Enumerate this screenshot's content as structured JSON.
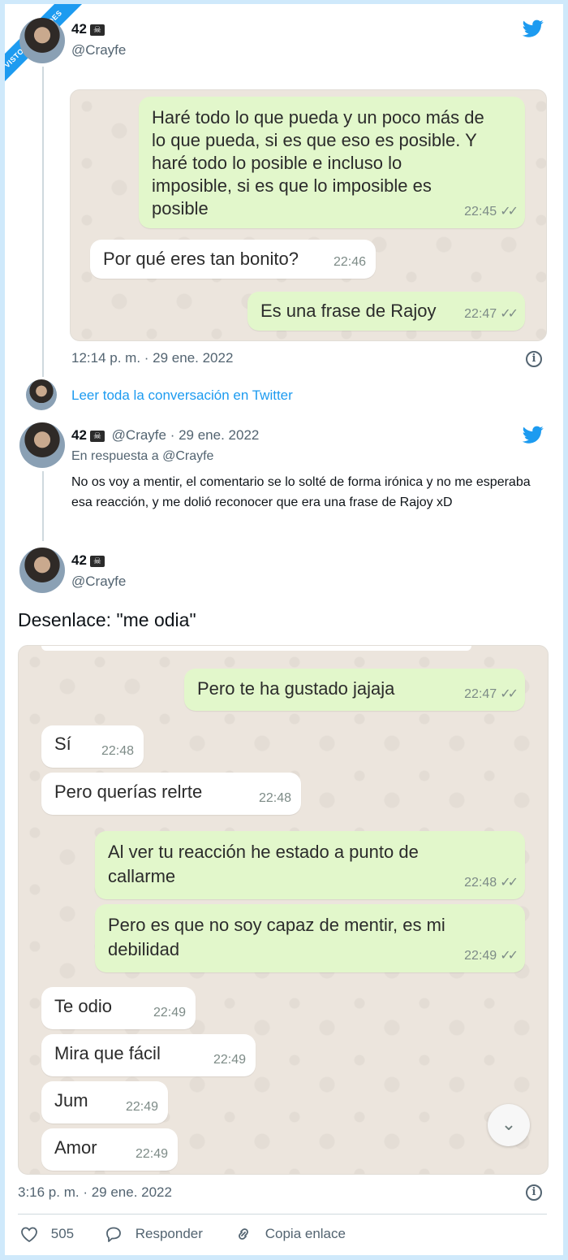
{
  "tweet1": {
    "name": "42",
    "handle": "@Crayfe",
    "chat": {
      "msg1_text": "Haré todo lo que pueda y un poco más de\nlo que pueda, si es que eso es posible. Y\nharé todo lo posible e incluso lo\nimposible, si es que lo imposible es\nposible",
      "msg1_time": "22:45",
      "msg2_text": "Por qué eres tan bonito?",
      "msg2_time": "22:46",
      "msg3_text": "Es una frase de Rajoy",
      "msg3_time": "22:47"
    },
    "timestamp": "12:14 p. m. · 29 ene. 2022"
  },
  "read_more": "Leer toda la conversación en Twitter",
  "reply": {
    "name": "42",
    "handle_date": "@Crayfe · 29 ene. 2022",
    "in_reply_to": "En respuesta a @Crayfe",
    "body": "No os voy a mentir, el comentario se lo solté de forma irónica y no me esperaba esa reacción, y me dolió reconocer que era una frase de Rajoy xD"
  },
  "tweet2": {
    "name": "42",
    "handle": "@Crayfe",
    "text": "Desenlace: \"me odia\"",
    "chat": {
      "m1_text": "Pero te ha gustado jajaja",
      "m1_time": "22:47",
      "m2_text": "Sí",
      "m2_time": "22:48",
      "m3_text": "Pero querías relrte",
      "m3_time": "22:48",
      "m4_text": "Al ver tu reacción he estado a punto de\ncallarme",
      "m4_time": "22:48",
      "m5_text": "Pero es que no soy capaz de mentir, es mi\ndebilidad",
      "m5_time": "22:49",
      "m6_text": "Te odio",
      "m6_time": "22:49",
      "m7_text": "Mira que fácil",
      "m7_time": "22:49",
      "m8_text": "Jum",
      "m8_time": "22:49",
      "m9_text": "Amor",
      "m9_time": "22:49"
    },
    "timestamp": "3:16 p. m. · 29 ene. 2022"
  },
  "actions": {
    "likes": "505",
    "reply_label": "Responder",
    "copy_label": "Copia enlace"
  },
  "colors": {
    "twitter_blue": "#1d9bf0",
    "outgoing_bubble": "#e2f7cb",
    "incoming_bubble": "#ffffff",
    "chat_background": "#ece5dd"
  },
  "icons": [
    "twitter-bird-icon",
    "info-icon",
    "heart-icon",
    "reply-icon",
    "link-icon",
    "skull-icon",
    "double-check-icon",
    "chevron-down-icon"
  ]
}
